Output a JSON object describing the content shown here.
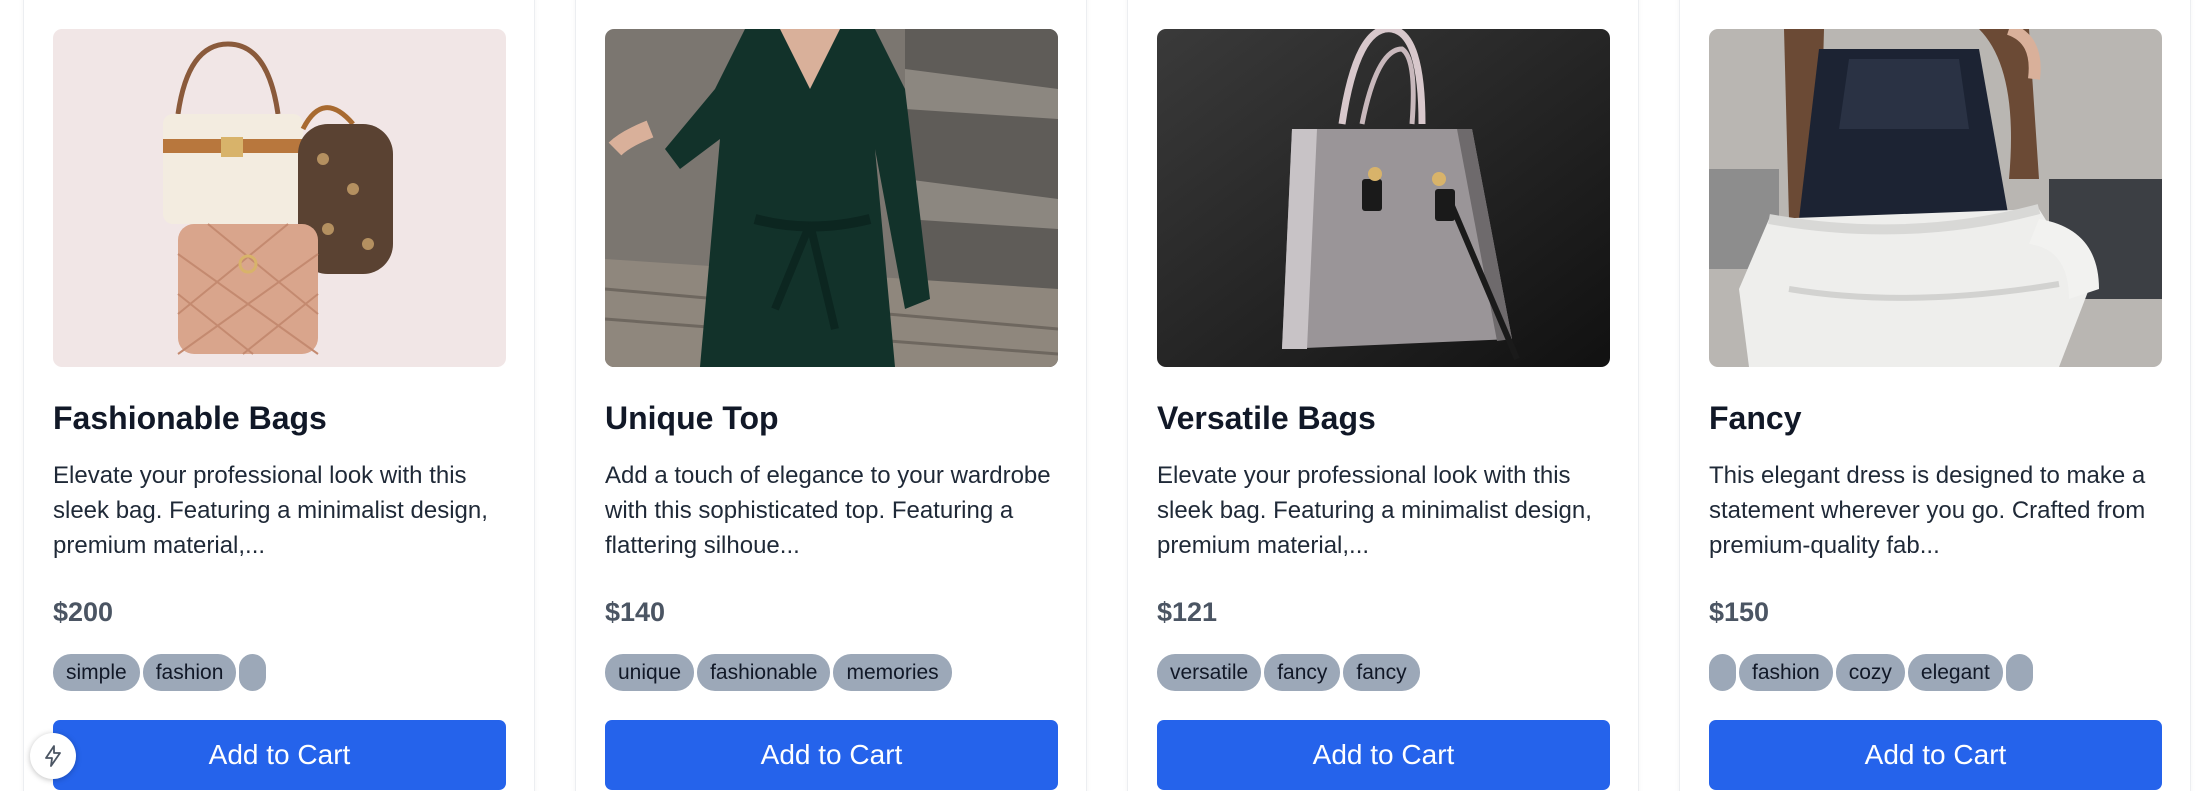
{
  "products": [
    {
      "title": "Fashionable Bags",
      "description": "Elevate your professional look with this sleek bag. Featuring a minimalist design, premium material,...",
      "price": "$200",
      "tags": [
        "simple",
        "fashion",
        ""
      ],
      "cart_label": "Add to Cart",
      "image": "handbags-photo"
    },
    {
      "title": "Unique Top",
      "description": "Add a touch of elegance to your wardrobe with this sophisticated top. Featuring a flattering silhoue...",
      "price": "$140",
      "tags": [
        "unique",
        "fashionable",
        "memories"
      ],
      "cart_label": "Add to Cart",
      "image": "green-dress-photo"
    },
    {
      "title": "Versatile Bags",
      "description": "Elevate your professional look with this sleek bag. Featuring a minimalist design, premium material,...",
      "price": "$121",
      "tags": [
        "versatile",
        "fancy",
        "fancy"
      ],
      "cart_label": "Add to Cart",
      "image": "grey-bag-photo"
    },
    {
      "title": "Fancy",
      "description": "This elegant dress is designed to make a statement wherever you go. Crafted from premium-quality fab...",
      "price": "$150",
      "tags": [
        "",
        "fashion",
        "cozy",
        "elegant",
        ""
      ],
      "cart_label": "Add to Cart",
      "image": "ruffle-top-photo"
    }
  ],
  "floating_button_icon": "lightning-icon",
  "colors": {
    "button": "#2563eb",
    "tag": "#9ca8b8",
    "price": "#4b5563"
  }
}
